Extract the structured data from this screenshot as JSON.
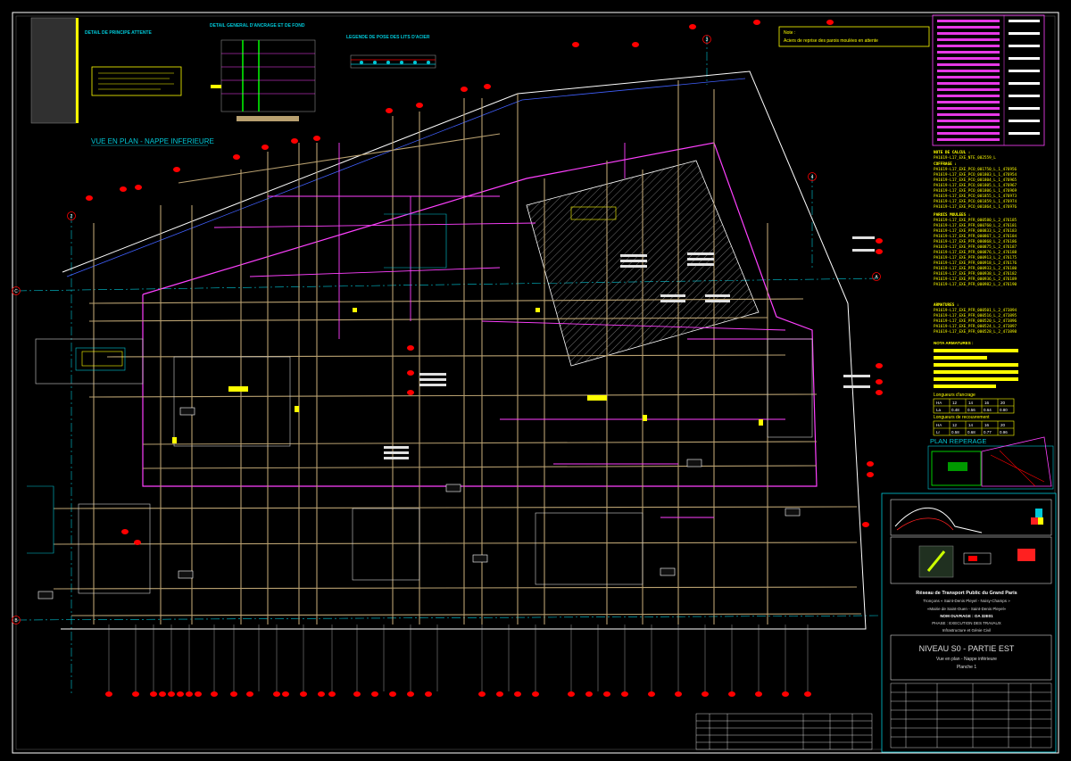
{
  "drawing": {
    "view_title": "VUE EN PLAN - NAPPE INFERIEURE",
    "detail_titles": [
      "DETAIL DE PRINCIPE ATTENTE",
      "DETAIL GENERAL D'ANCRAGE ET DE FOND",
      "LEGENDE DE POSE DES LITS D'ACIER"
    ],
    "note_label": "Note :",
    "note_text": "Aciers de reprise des parois moulées en attente",
    "reperage_title": "PLAN REPERAGE",
    "axis_letters": [
      "C",
      "B",
      "A"
    ],
    "axis_numbers": [
      "2",
      "3",
      "4"
    ]
  },
  "right_panel": {
    "calc_title": "NOTE DE CALCUL :",
    "calc_ref": "PA1619-L17_EXE_NTE_002559_L",
    "coffrage_title": "COFFRAGE :",
    "coffrage_items": [
      "PA1619-L17_EXE_PCO_001750_L_1_476956",
      "PA1619-L17_EXE_PCO_001803_L_1_476954",
      "PA1619-L17_EXE_PCO_001804_L_1_476965",
      "PA1619-L17_EXE_PCO_001805_L_1_476967",
      "PA1619-L17_EXE_PCO_001806_L_1_476969",
      "PA1619-L17_EXE_PCO_001855_L_1_476973",
      "PA1619-L17_EXE_PCO_001859_L_1_476974",
      "PA1619-L17_EXE_PCO_001864_L_1_476976"
    ],
    "parois_title": "PAROIS MOULEES :",
    "parois_items": [
      "PA1619-L17_EXE_PFR_000580_L_2_476185",
      "PA1619-L17_EXE_PFR_000760_L_2_476181",
      "PA1619-L17_EXE_PFR_000833_L_2_476183",
      "PA1619-L17_EXE_PFR_000867_L_2_476184",
      "PA1619-L17_EXE_PFR_000868_L_2_476186",
      "PA1619-L17_EXE_PFR_000875_L_2_476187",
      "PA1619-L17_EXE_PFR_000876_L_2_476188",
      "PA1619-L17_EXE_PFR_000913_L_2_476175",
      "PA1619-L17_EXE_PFR_000918_L_2_476176",
      "PA1619-L17_EXE_PFR_000933_L_2_476180",
      "PA1619-L17_EXE_PFR_000938_L_2_476182",
      "PA1619-L17_EXE_PFR_000936_L_2_476189",
      "PA1619-L17_EXE_PFR_000982_L_2_476190"
    ],
    "armatures_title": "ARMATURES :",
    "armatures_items": [
      "PA1619-L17_EXE_PFR_000501_L_2_473894",
      "PA1619-L17_EXE_PFR_000516_L_2_473895",
      "PA1619-L17_EXE_PFR_000520_L_2_473896",
      "PA1619-L17_EXE_PFR_000524_L_2_473897",
      "PA1619-L17_EXE_PFR_000528_L_2_473898"
    ],
    "armatures_note_title": "NOTA ARMATURES :",
    "ancrage_title": "Longueurs d'ancrage",
    "recouvrement_title": "Longueurs de recouvrement",
    "ancrage_rows": [
      [
        "HA",
        "12",
        "14",
        "16",
        "20"
      ],
      [
        "La",
        "0.48",
        "0.56",
        "0.64",
        "0.80"
      ]
    ],
    "recouvrement_rows": [
      [
        "HA",
        "12",
        "14",
        "16",
        "20"
      ],
      [
        "Lr",
        "0.58",
        "0.68",
        "0.77",
        "0.96"
      ]
    ]
  },
  "title_block": {
    "client": "Réseau de Transport Public du Grand Paris",
    "troncon": "Tronçons « Saint-Denis Pleyel - Noisy-Champs »",
    "station": "«Mairie de Saint-Ouen - Saint-Denis Pleyel»",
    "ouvrage": "NOM OUVRAGE : OA 32E01",
    "phase": "PHASE : EXECUTION DES TRAVAUX",
    "discipline": "Infrastructure et Génie Civil",
    "sheet_title": "NIVEAU S0 - PARTIE EST",
    "sheet_subtitle": "Vue en plan - Nappe inférieure",
    "planche": "Planche 1"
  },
  "colors": {
    "background": "#000000",
    "frame": "#ffffff",
    "cyan": "#00c8d8",
    "magenta": "#ff40ff",
    "yellow": "#ffff00",
    "red": "#ff0000",
    "tan": "#b8a070",
    "green": "#00ff00"
  }
}
